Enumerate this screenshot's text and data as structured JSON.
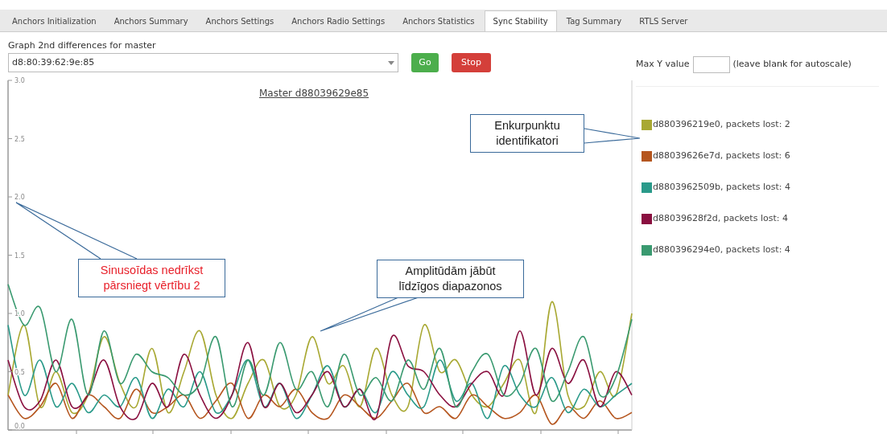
{
  "tabs": [
    {
      "label": "Anchors Initialization",
      "selected": false
    },
    {
      "label": "Anchors Summary",
      "selected": false
    },
    {
      "label": "Anchors Settings",
      "selected": false
    },
    {
      "label": "Anchors Radio Settings",
      "selected": false
    },
    {
      "label": "Anchors Statistics",
      "selected": false
    },
    {
      "label": "Sync Stability",
      "selected": true
    },
    {
      "label": "Tag Summary",
      "selected": false
    },
    {
      "label": "RTLS Server",
      "selected": false
    }
  ],
  "master": {
    "label": "Graph 2nd differences for master",
    "value": "d8:80:39:62:9e:85",
    "buttons": [
      {
        "label": "Go",
        "kind": "go"
      },
      {
        "label": "Stop",
        "kind": "stop"
      }
    ]
  },
  "max_y": {
    "label": "Max Y value",
    "hint": "(leave blank for autoscale)"
  },
  "chart": {
    "title": "Master d88039629e85",
    "chart_data": {
      "type": "line",
      "ylim": [
        0,
        3
      ],
      "yticks": [
        {
          "value": 0,
          "label": "0.0"
        },
        {
          "value": 0.5,
          "label": "0.5"
        },
        {
          "value": 1,
          "label": "1.0"
        },
        {
          "value": 1.5,
          "label": "1.5"
        },
        {
          "value": 2,
          "label": "2.0"
        },
        {
          "value": 2.5,
          "label": "2.5"
        },
        {
          "value": 3,
          "label": "3.0"
        }
      ],
      "series": [
        {
          "name": "d880396219e0",
          "color": "#a8a832",
          "values": [
            0.3,
            0.9,
            0.2,
            0.5,
            0.15,
            0.3,
            0.8,
            0.4,
            0.2,
            0.7,
            0.15,
            0.5,
            0.85,
            0.3,
            0.1,
            0.4,
            0.6,
            0.2,
            0.3,
            0.8,
            0.4,
            0.55,
            0.2,
            0.7,
            0.3,
            0.2,
            0.9,
            0.5,
            0.6,
            0.3,
            0.2,
            0.4,
            0.6,
            0.15,
            1.1,
            0.3,
            0.2,
            0.5,
            0.3,
            1.0
          ]
        },
        {
          "name": "d88039626e7d",
          "color": "#b5561f",
          "values": [
            0.3,
            0.1,
            0.2,
            0.4,
            0.1,
            0.3,
            0.2,
            0.1,
            0.35,
            0.15,
            0.2,
            0.3,
            0.1,
            0.25,
            0.4,
            0.1,
            0.3,
            0.2,
            0.35,
            0.15,
            0.1,
            0.3,
            0.2,
            0.1,
            0.25,
            0.4,
            0.15,
            0.2,
            0.1,
            0.3,
            0.2,
            0.1,
            0.15,
            0.3,
            0.05,
            0.2,
            0.1,
            0.25,
            0.1,
            0.15
          ]
        },
        {
          "name": "d8803962509b",
          "color": "#2a9a8a",
          "values": [
            0.9,
            0.3,
            0.6,
            0.2,
            0.4,
            0.15,
            0.3,
            0.2,
            0.45,
            0.1,
            0.35,
            0.2,
            0.5,
            0.15,
            0.3,
            0.6,
            0.2,
            0.4,
            0.1,
            0.3,
            0.55,
            0.2,
            0.35,
            0.15,
            0.5,
            0.3,
            0.2,
            0.6,
            0.25,
            0.4,
            0.1,
            0.55,
            0.3,
            0.2,
            0.45,
            0.15,
            0.35,
            0.2,
            0.3,
            0.4
          ]
        },
        {
          "name": "d88039628f2d",
          "color": "#8a1040",
          "values": [
            0.6,
            0.2,
            0.25,
            0.6,
            0.2,
            0.3,
            0.6,
            0.2,
            0.1,
            0.4,
            0.2,
            0.65,
            0.3,
            0.1,
            0.3,
            0.75,
            0.2,
            0.4,
            0.15,
            0.3,
            0.5,
            0.2,
            0.35,
            0.1,
            0.8,
            0.55,
            0.5,
            0.3,
            0.2,
            0.4,
            0.5,
            0.3,
            0.85,
            0.3,
            0.7,
            0.4,
            0.6,
            0.2,
            0.5,
            0.3
          ]
        },
        {
          "name": "d880396294e0",
          "color": "#3a9a70",
          "values": [
            1.25,
            0.9,
            1.05,
            0.5,
            0.95,
            0.3,
            0.85,
            0.4,
            0.65,
            0.5,
            0.45,
            0.3,
            0.4,
            0.8,
            0.2,
            0.6,
            0.3,
            0.75,
            0.35,
            0.5,
            0.2,
            0.65,
            0.3,
            0.45,
            0.25,
            0.6,
            0.35,
            0.7,
            0.2,
            0.5,
            0.65,
            0.3,
            0.4,
            0.7,
            0.25,
            0.5,
            0.8,
            0.3,
            0.45,
            0.95
          ]
        }
      ]
    }
  },
  "legend": [
    {
      "suffix": ", packets lost: 2"
    },
    {
      "suffix": ", packets lost: 6"
    },
    {
      "suffix": ", packets lost: 4"
    },
    {
      "suffix": ", packets lost: 4"
    },
    {
      "suffix": ", packets lost: 4"
    }
  ],
  "callouts": [
    {
      "lines": [
        "Enkurpunktu",
        "identifikatori"
      ],
      "kind": "note"
    },
    {
      "lines": [
        "Sinusoīdas nedrīkst",
        "pārsniegt vērtību 2"
      ],
      "kind": "warning"
    },
    {
      "lines": [
        "Amplitūdām jābūt",
        "līdzīgos diapazonos"
      ],
      "kind": "note"
    }
  ]
}
